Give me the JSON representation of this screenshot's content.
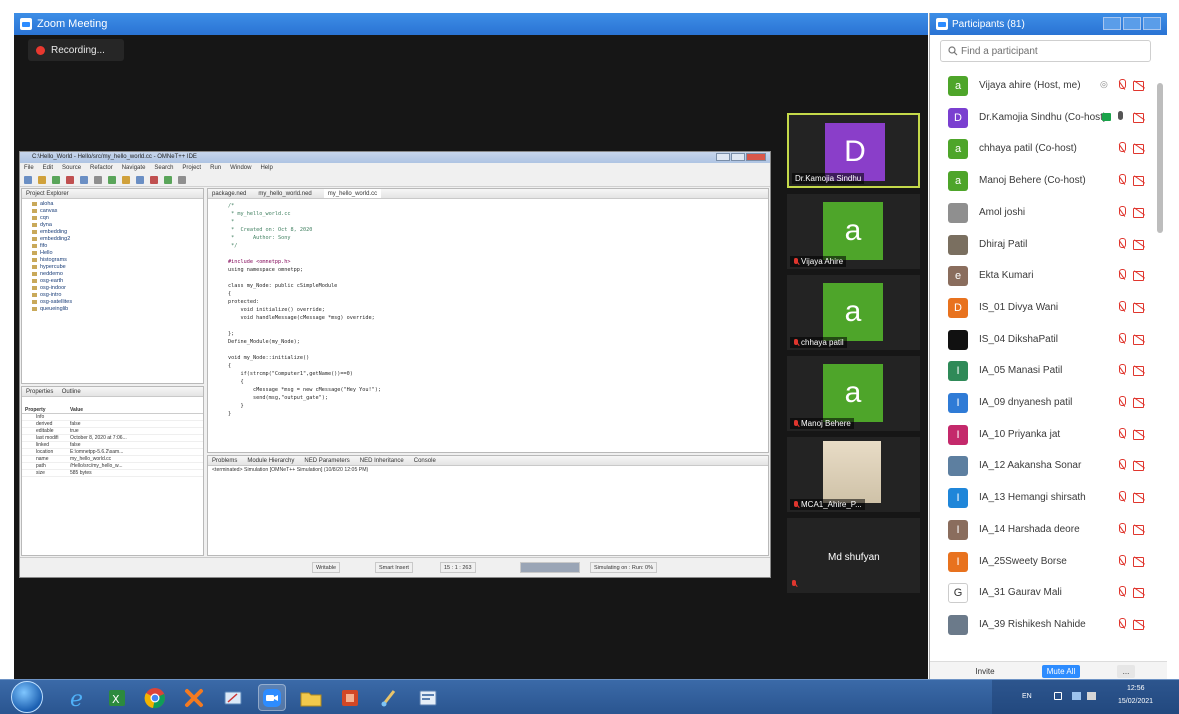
{
  "zoom": {
    "title": "Zoom Meeting",
    "recording": "Recording..."
  },
  "eclipse": {
    "title": "C:\\Hello_World - Hello/src/my_hello_world.cc - OMNeT++ IDE",
    "menu": [
      "File",
      "Edit",
      "Source",
      "Refactor",
      "Navigate",
      "Search",
      "Project",
      "Run",
      "Window",
      "Help"
    ],
    "project_explorer_tab": "Project Explorer",
    "tree": [
      "aloha",
      "canvas",
      "cqn",
      "dyna",
      "embedding",
      "embedding2",
      "fifo",
      "Hello",
      "histograms",
      "hypercube",
      "neddemo",
      "osg-earth",
      "osg-indoor",
      "osg-intro",
      "osg-satellites",
      "queueinglib"
    ],
    "properties_tab": "Properties",
    "outline_tab": "Outline",
    "prop_header": [
      "Property",
      "Value"
    ],
    "props": [
      [
        "Info",
        ""
      ],
      [
        "derived",
        "false"
      ],
      [
        "editable",
        "true"
      ],
      [
        "last modifi",
        "October 8, 2020 at 7:06..."
      ],
      [
        "linked",
        "false"
      ],
      [
        "location",
        "E:\\omnetpp-5.6.2\\sam..."
      ],
      [
        "name",
        "my_hello_world.cc"
      ],
      [
        "path",
        "/Hello/src/my_hello_w..."
      ],
      [
        "size",
        "585 bytes"
      ]
    ],
    "editor_tabs": [
      "package.ned",
      "my_hello_world.ned",
      "my_hello_world.cc"
    ],
    "code": [
      "/*",
      " * my_hello_world.cc",
      " *",
      " *  Created on: Oct 8, 2020",
      " *      Author: Sony",
      " */",
      "",
      "#include <omnetpp.h>",
      "using namespace omnetpp;",
      "",
      "class my_Node: public cSimpleModule",
      "{",
      "protected:",
      "    void initialize() override;",
      "    void handleMessage(cMessage *msg) override;",
      "",
      "};",
      "Define_Module(my_Node);",
      "",
      "void my_Node::initialize()",
      "{",
      "    if(strcmp(\"Computer1\",getName())==0)",
      "    {",
      "        cMessage *msg = new cMessage(\"Hey You!\");",
      "        send(msg,\"output_gate\");",
      "    }",
      "}"
    ],
    "console_tabs": [
      "Problems",
      "Module Hierarchy",
      "NED Parameters",
      "NED Inheritance",
      "Console"
    ],
    "console_line": "<terminated> Simulation [OMNeT++ Simulation] (10/8/20 12:05 PM)",
    "status": [
      "Writable",
      "Smart Insert",
      "15 : 1 : 263",
      "Simulating on : Run: 0%"
    ]
  },
  "tiles": [
    {
      "name": "Dr.Kamojia Sindhu",
      "initial": "D",
      "color": "#8a3ec9",
      "muted": false
    },
    {
      "name": "Vijaya Ahire",
      "initial": "a",
      "color": "#4ea52a",
      "muted": true
    },
    {
      "name": "chhaya patil",
      "initial": "a",
      "color": "#4ea52a",
      "muted": true
    },
    {
      "name": "Manoj Behere",
      "initial": "a",
      "color": "#4ea52a",
      "muted": true
    },
    {
      "name": "MCA1_Ahire_P...",
      "initial": "",
      "color": "#cfc2a8",
      "muted": true
    },
    {
      "name": "Md shufyan",
      "initial": "",
      "color": "",
      "muted": true
    }
  ],
  "participants": {
    "title": "Participants (81)",
    "search_placeholder": "Find a participant",
    "list": [
      {
        "name": "Vijaya ahire (Host, me)",
        "initial": "a",
        "color": "#4ea52a"
      },
      {
        "name": "Dr.Kamojia Sindhu (Co-host)",
        "initial": "D",
        "color": "#7a3fd0"
      },
      {
        "name": "chhaya patil (Co-host)",
        "initial": "a",
        "color": "#4ea52a"
      },
      {
        "name": "Manoj Behere (Co-host)",
        "initial": "a",
        "color": "#4ea52a"
      },
      {
        "name": "Amol joshi",
        "initial": "",
        "color": "#8f8f8f"
      },
      {
        "name": "Dhiraj Patil",
        "initial": "",
        "color": "#7a6f60"
      },
      {
        "name": "Ekta Kumari",
        "initial": "e",
        "color": "#8a6d5d"
      },
      {
        "name": "IS_01 Divya Wani",
        "initial": "D",
        "color": "#e8721e"
      },
      {
        "name": "IS_04 DikshaPatil",
        "initial": "",
        "color": "#111111"
      },
      {
        "name": "IA_05 Manasi Patil",
        "initial": "I",
        "color": "#2f8a58"
      },
      {
        "name": "IA_09 dnyanesh patil",
        "initial": "I",
        "color": "#2f7bd6"
      },
      {
        "name": "IA_10 Priyanka jat",
        "initial": "I",
        "color": "#c4296b"
      },
      {
        "name": "IA_12 Aakansha Sonar",
        "initial": "",
        "color": "#5d7fa0"
      },
      {
        "name": "IA_13 Hemangi shirsath",
        "initial": "I",
        "color": "#1f86d9"
      },
      {
        "name": "IA_14 Harshada deore",
        "initial": "I",
        "color": "#8a6d5d"
      },
      {
        "name": "IA_25Sweety Borse",
        "initial": "I",
        "color": "#e8721e"
      },
      {
        "name": "IA_31 Gaurav Mali",
        "initial": "G",
        "color": "#ffffff"
      },
      {
        "name": "IA_39 Rishikesh Nahide",
        "initial": "",
        "color": "#6b7a8a"
      }
    ],
    "invite_label": "Invite",
    "mute_all_label": "Mute All",
    "more_label": "..."
  },
  "taskbar": {
    "lang": "EN",
    "time": "12:56",
    "date": "15/02/2021"
  }
}
